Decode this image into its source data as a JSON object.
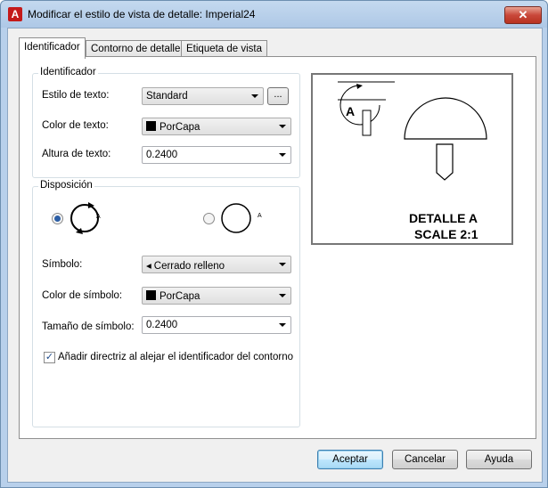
{
  "window": {
    "title": "Modificar el estilo de vista de detalle: Imperial24",
    "app_icon_letter": "A",
    "close_glyph": "✕"
  },
  "tabs": [
    {
      "label": "Identificador",
      "active": true
    },
    {
      "label": "Contorno de detalle",
      "active": false
    },
    {
      "label": "Etiqueta de vista",
      "active": false
    }
  ],
  "identificador": {
    "group_label": "Identificador",
    "estilo_label": "Estilo de texto:",
    "estilo_value": "Standard",
    "browse_label": "...",
    "color_label": "Color de texto:",
    "color_value": "PorCapa",
    "altura_label": "Altura de texto:",
    "altura_value": "0.2400"
  },
  "disposicion": {
    "group_label": "Disposición",
    "option1_letter": "A",
    "option2_letter": "A",
    "selected_option": 1,
    "simbolo_label": "Símbolo:",
    "simbolo_value": "Cerrado relleno",
    "simbolo_glyph": "◂",
    "color_simbolo_label": "Color de símbolo:",
    "color_simbolo_value": "PorCapa",
    "tamano_label": "Tamaño de símbolo:",
    "tamano_value": "0.2400",
    "checkbox_label": "Añadir directriz al alejar el identificador del contorno",
    "checkbox_checked": true,
    "check_glyph": "✓"
  },
  "preview": {
    "marker_letter": "A",
    "caption_line1": "DETALLE A",
    "caption_line2": "SCALE 2:1"
  },
  "buttons": {
    "accept": "Aceptar",
    "cancel": "Cancelar",
    "help": "Ayuda"
  },
  "colors": {
    "title_bar": "#b8d0eb",
    "close_button": "#c9483a",
    "radio_selected": "#2c5ea5",
    "default_button_border": "#3c7fb1"
  }
}
